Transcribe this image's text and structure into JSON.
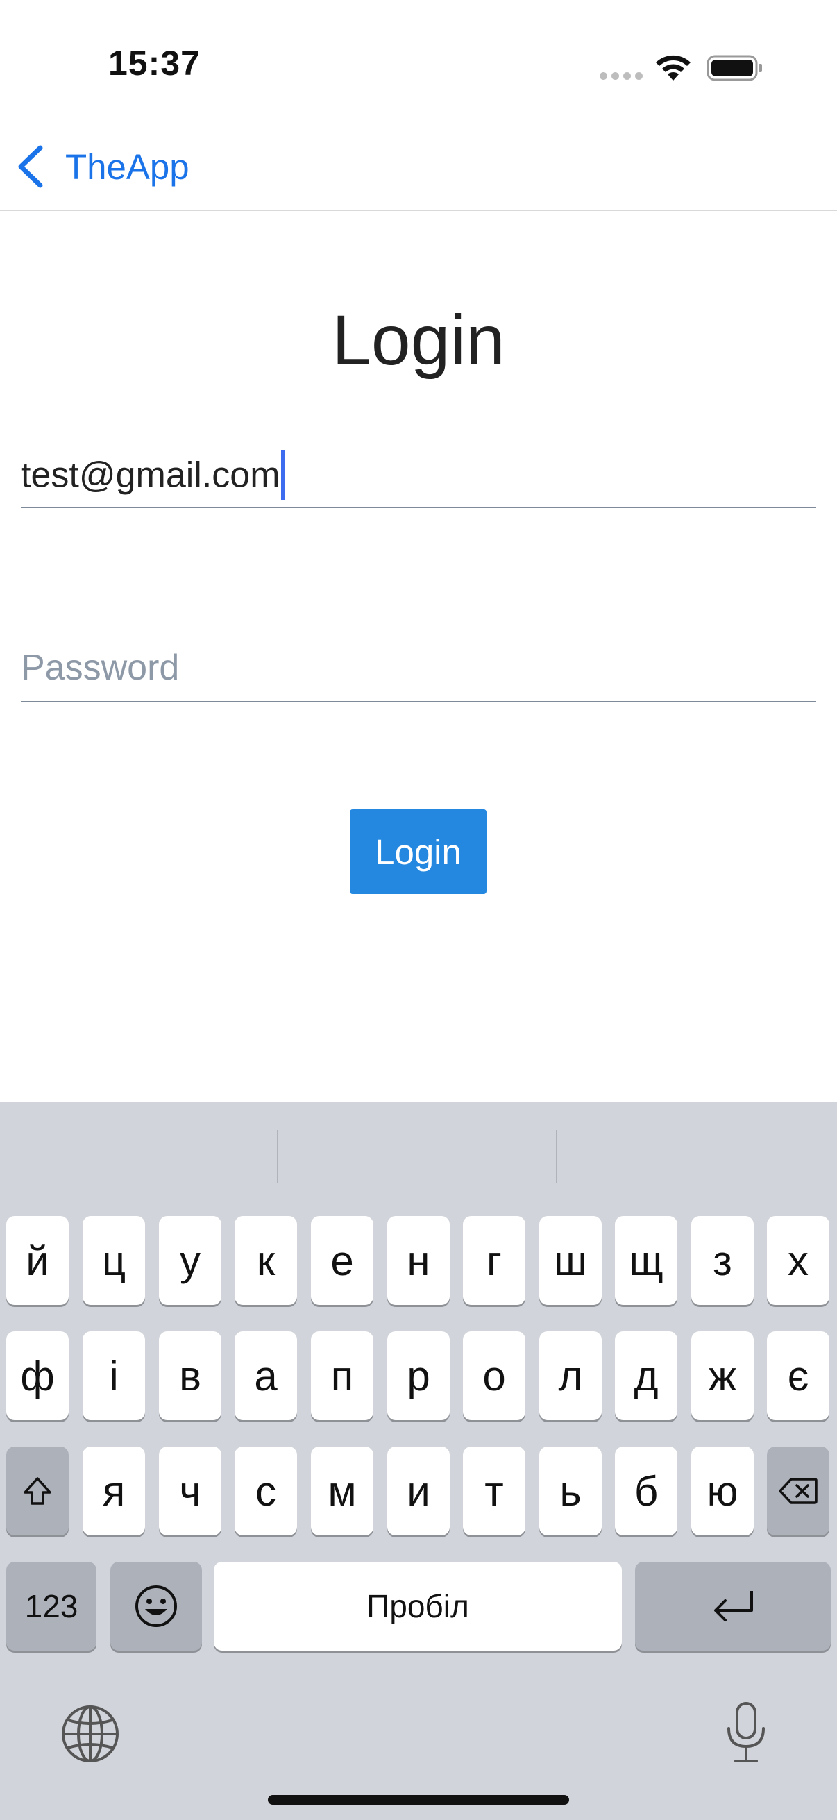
{
  "status_bar": {
    "time": "15:37"
  },
  "nav": {
    "back_label": "TheApp"
  },
  "page": {
    "title": "Login"
  },
  "form": {
    "email_value": "test@gmail.com",
    "password_placeholder": "Password",
    "login_button": "Login"
  },
  "keyboard": {
    "row1": [
      "й",
      "ц",
      "у",
      "к",
      "е",
      "н",
      "г",
      "ш",
      "щ",
      "з",
      "х"
    ],
    "row2": [
      "ф",
      "і",
      "в",
      "а",
      "п",
      "р",
      "о",
      "л",
      "д",
      "ж",
      "є"
    ],
    "row3": [
      "я",
      "ч",
      "с",
      "м",
      "и",
      "т",
      "ь",
      "б",
      "ю"
    ],
    "numbers_key": "123",
    "space_key": "Пробіл"
  },
  "icons": {
    "back": "chevron-left-icon",
    "wifi": "wifi-icon",
    "battery": "battery-icon",
    "shift": "shift-icon",
    "backspace": "backspace-icon",
    "emoji": "emoji-icon",
    "return": "return-icon",
    "globe": "globe-icon",
    "mic": "microphone-icon"
  },
  "colors": {
    "accent": "#1a73e8",
    "button": "#2488e0",
    "keyboard_bg": "#d1d4da",
    "caret": "#3d6cf0"
  }
}
